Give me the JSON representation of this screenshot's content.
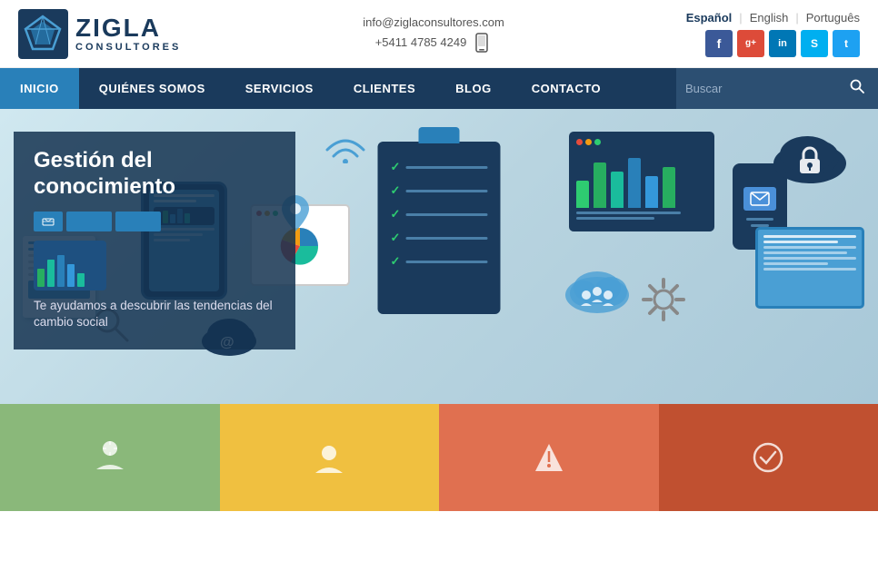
{
  "brand": {
    "name_main": "ZIGLA",
    "name_sub": "CONSULTORES",
    "logo_icon": "diamond-icon"
  },
  "contact": {
    "email": "info@ziglaconsultores.com",
    "phone": "+5411 4785 4249"
  },
  "languages": {
    "options": [
      {
        "code": "es",
        "label": "Español",
        "active": true
      },
      {
        "code": "en",
        "label": "English",
        "active": false
      },
      {
        "code": "pt",
        "label": "Português",
        "active": false
      }
    ]
  },
  "social": {
    "links": [
      {
        "name": "Facebook",
        "icon": "f",
        "class": "fb"
      },
      {
        "name": "Google+",
        "icon": "g+",
        "class": "gp"
      },
      {
        "name": "LinkedIn",
        "icon": "in",
        "class": "li"
      },
      {
        "name": "Skype",
        "icon": "S",
        "class": "sk"
      },
      {
        "name": "Twitter",
        "icon": "t",
        "class": "tw"
      }
    ]
  },
  "nav": {
    "items": [
      {
        "label": "INICIO",
        "active": true
      },
      {
        "label": "QUIÉNES SOMOS",
        "active": false
      },
      {
        "label": "SERVICIOS",
        "active": false
      },
      {
        "label": "CLIENTES",
        "active": false
      },
      {
        "label": "BLOG",
        "active": false
      },
      {
        "label": "CONTACTO",
        "active": false
      }
    ],
    "search_placeholder": "Buscar"
  },
  "hero": {
    "title": "Gestión del conocimiento",
    "subtitle": "Te ayudamos a descubrir las tendencias del cambio social"
  },
  "cards": [
    {
      "color": "#8ab87a",
      "id": "card-1"
    },
    {
      "color": "#f0c040",
      "id": "card-2"
    },
    {
      "color": "#e07050",
      "id": "card-3"
    },
    {
      "color": "#c05030",
      "id": "card-4"
    }
  ]
}
